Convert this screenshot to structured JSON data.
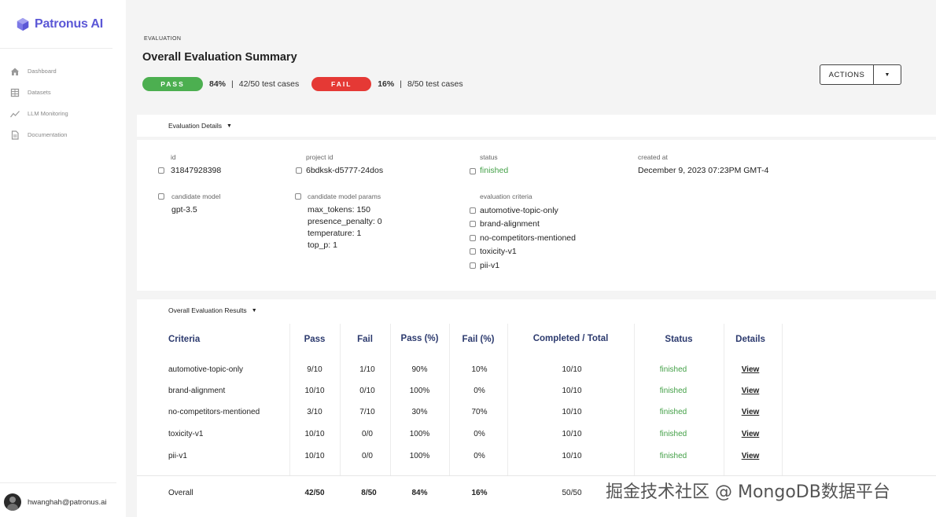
{
  "app": {
    "name": "Patronus AI",
    "brand_color": "#5b57d6"
  },
  "sidebar": {
    "items": [
      {
        "label": "Dashboard",
        "icon": "home-icon"
      },
      {
        "label": "Datasets",
        "icon": "table-icon"
      },
      {
        "label": "LLM Monitoring",
        "icon": "chart-line-icon"
      },
      {
        "label": "Documentation",
        "icon": "document-icon"
      }
    ],
    "user_email": "hwanghah@patronus.ai"
  },
  "header": {
    "eyebrow": "EVALUATION",
    "title": "Overall Evaluation Summary",
    "pass_label": "PASS",
    "pass_pct": "84%",
    "pass_cases": "42/50 test cases",
    "fail_label": "FAIL",
    "fail_pct": "16%",
    "fail_cases": "8/50 test cases",
    "separator": "|",
    "actions_label": "ACTIONS",
    "pass_color": "#4caf50",
    "fail_color": "#e53935"
  },
  "details": {
    "section_label": "Evaluation Details",
    "id_label": "id",
    "id_value": "31847928398",
    "project_id_label": "project id",
    "project_id_value": "6bdksk-d5777-24dos",
    "status_label": "status",
    "status_value": "finished",
    "created_at_label": "created at",
    "created_at_value": "December 9, 2023 07:23PM GMT-4",
    "candidate_model_label": "candidate model",
    "candidate_model_value": "gpt-3.5",
    "params_label": "candidate model params",
    "params": [
      "max_tokens: 150",
      "presence_penalty: 0",
      "temperature: 1",
      "top_p: 1"
    ],
    "criteria_label": "evaluation criteria",
    "criteria": [
      "automotive-topic-only",
      "brand-alignment",
      "no-competitors-mentioned",
      "toxicity-v1",
      "pii-v1"
    ]
  },
  "results": {
    "section_label": "Overall Evaluation Results",
    "columns": [
      "Criteria",
      "Pass",
      "Fail",
      "Pass (%)",
      "Fail (%)",
      "Completed / Total",
      "Status",
      "Details"
    ],
    "rows": [
      {
        "criteria": "automotive-topic-only",
        "pass": "9/10",
        "fail": "1/10",
        "pass_pct": "90%",
        "fail_pct": "10%",
        "completed": "10/10",
        "status": "finished",
        "details": "View"
      },
      {
        "criteria": "brand-alignment",
        "pass": "10/10",
        "fail": "0/10",
        "pass_pct": "100%",
        "fail_pct": "0%",
        "completed": "10/10",
        "status": "finished",
        "details": "View"
      },
      {
        "criteria": "no-competitors-mentioned",
        "pass": "3/10",
        "fail": "7/10",
        "pass_pct": "30%",
        "fail_pct": "70%",
        "completed": "10/10",
        "status": "finished",
        "details": "View"
      },
      {
        "criteria": "toxicity-v1",
        "pass": "10/10",
        "fail": "0/0",
        "pass_pct": "100%",
        "fail_pct": "0%",
        "completed": "10/10",
        "status": "finished",
        "details": "View"
      },
      {
        "criteria": "pii-v1",
        "pass": "10/10",
        "fail": "0/0",
        "pass_pct": "100%",
        "fail_pct": "0%",
        "completed": "10/10",
        "status": "finished",
        "details": "View"
      }
    ],
    "overall": {
      "label": "Overall",
      "pass": "42/50",
      "fail": "8/50",
      "pass_pct": "84%",
      "fail_pct": "16%",
      "completed": "50/50"
    }
  },
  "watermark": "掘金技术社区 @ MongoDB数据平台"
}
